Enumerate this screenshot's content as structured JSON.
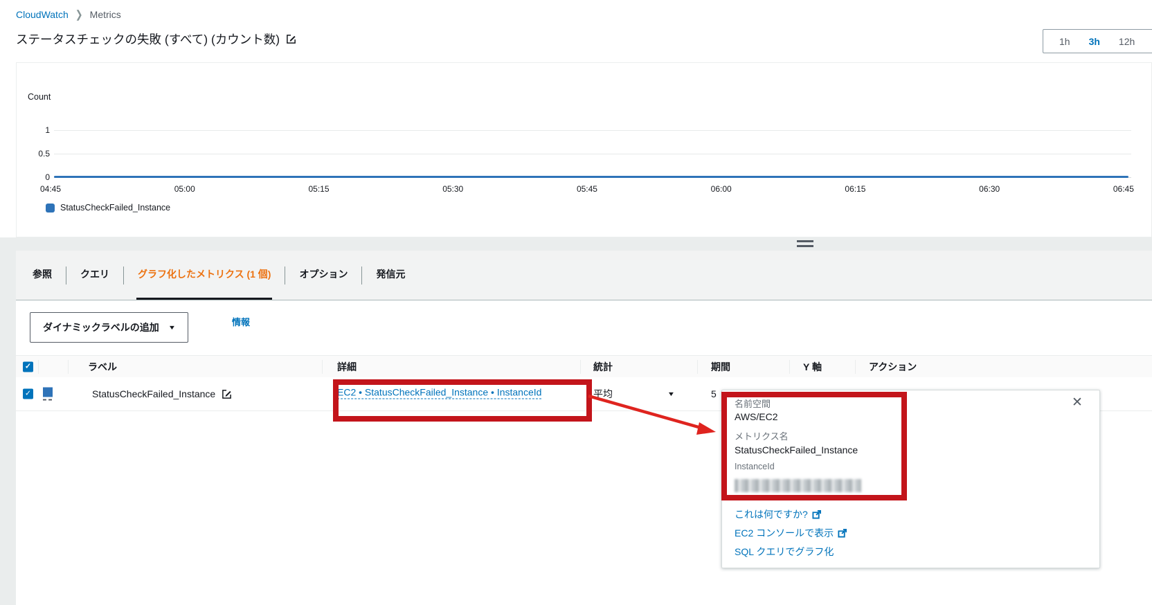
{
  "breadcrumb": {
    "cloudwatch": "CloudWatch",
    "metrics": "Metrics"
  },
  "page": {
    "title": "ステータスチェックの失敗 (すべて) (カウント数)"
  },
  "time_range": {
    "options": [
      "1h",
      "3h",
      "12h"
    ],
    "selected": "3h"
  },
  "chart_data": {
    "type": "line",
    "ylabel": "Count",
    "yticks": [
      "1",
      "0.5",
      "0"
    ],
    "ylim": [
      0,
      1.25
    ],
    "x": [
      "04:45",
      "05:00",
      "05:15",
      "05:30",
      "05:45",
      "06:00",
      "06:15",
      "06:30",
      "06:45"
    ],
    "series": [
      {
        "name": "StatusCheckFailed_Instance",
        "color": "#2e73b8",
        "values": [
          0,
          0,
          0,
          0,
          0,
          0,
          0,
          0,
          0
        ]
      }
    ],
    "grid": "horizontal",
    "legend_position": "bottom-left"
  },
  "tabs": {
    "items": [
      {
        "label": "参照",
        "selected": false
      },
      {
        "label": "クエリ",
        "selected": false
      },
      {
        "label": "グラフ化したメトリクス (1 個)",
        "selected": true
      },
      {
        "label": "オプション",
        "selected": false
      },
      {
        "label": "発信元",
        "selected": false
      }
    ]
  },
  "toolbar": {
    "add_dynamic_label": "ダイナミックラベルの追加",
    "info_label": "情報"
  },
  "table": {
    "headers": {
      "label": "ラベル",
      "details": "詳細",
      "statistic": "統計",
      "period": "期間",
      "y_axis": "Y 軸",
      "actions": "アクション"
    },
    "rows": [
      {
        "checked": true,
        "color": "#2e73b8",
        "label": "StatusCheckFailed_Instance",
        "details": "EC2 • StatusCheckFailed_Instance • InstanceId",
        "statistic": "平均",
        "period_visible": "5"
      }
    ]
  },
  "popup": {
    "namespace_label": "名前空間",
    "namespace_value": "AWS/EC2",
    "metric_name_label": "メトリクス名",
    "metric_name_value": "StatusCheckFailed_Instance",
    "instance_id_label": "InstanceId",
    "instance_id_masked": true,
    "links": [
      {
        "label": "これは何ですか?",
        "external": true
      },
      {
        "label": "EC2 コンソールで表示",
        "external": true
      },
      {
        "label": "SQL クエリでグラフ化",
        "external": false
      }
    ],
    "close_icon": "✕"
  },
  "icons": {
    "caret_down": "▼",
    "check": "✓",
    "chevron_right": "❯"
  },
  "colors": {
    "link_blue": "#0073bb",
    "selected_tab_orange": "#ec7211",
    "chart_line_blue": "#2e73b8",
    "annotation_red": "#c3151b",
    "panel_gray": "#eaeded"
  }
}
